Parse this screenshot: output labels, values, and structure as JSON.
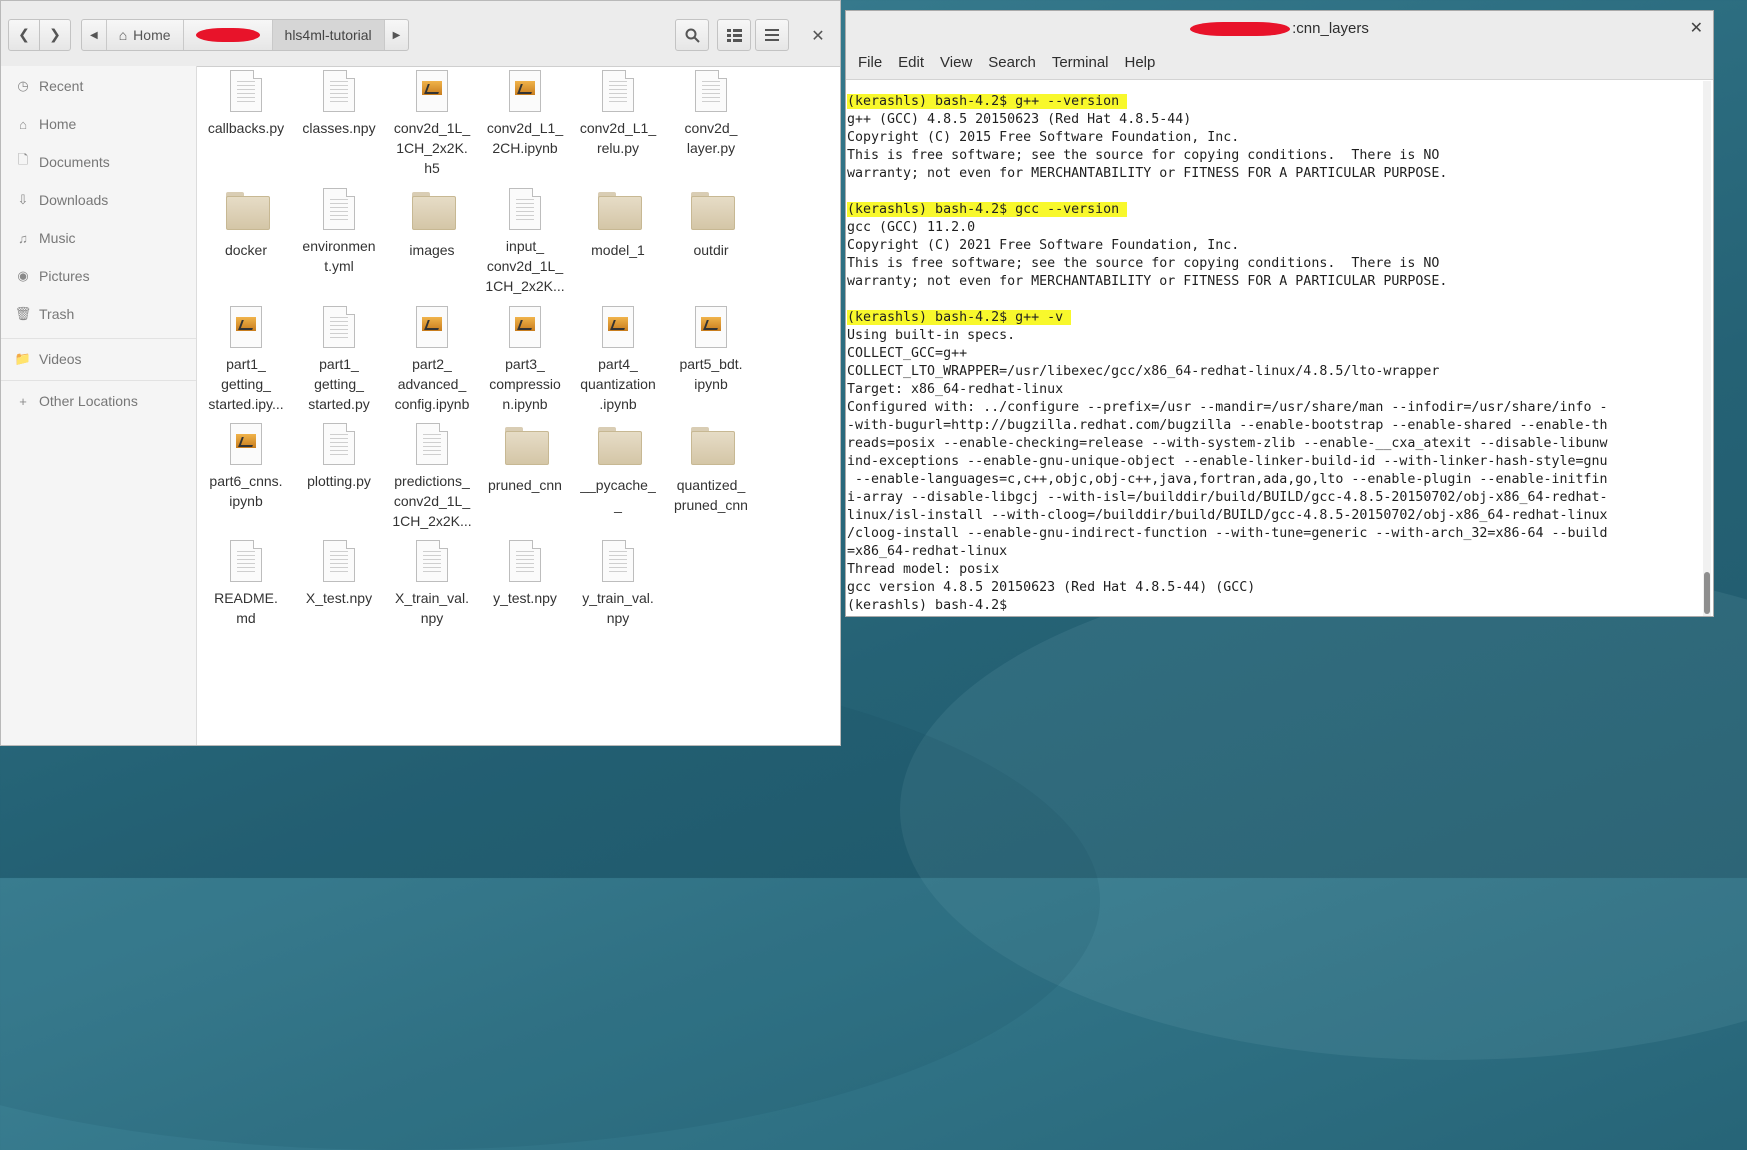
{
  "file_manager": {
    "breadcrumb": {
      "home_label": "Home",
      "current_folder": "hls4ml-tutorial"
    },
    "icons": {
      "back": "chevron-left-icon",
      "forward": "chevron-right-icon",
      "search": "search-icon",
      "view": "view-toggle-icon",
      "menu": "hamburger-menu-icon",
      "close": "close-icon"
    },
    "sidebar": {
      "items": [
        {
          "label": "Recent",
          "icon": "clock-icon"
        },
        {
          "label": "Home",
          "icon": "home-icon"
        },
        {
          "label": "Documents",
          "icon": "document-icon"
        },
        {
          "label": "Downloads",
          "icon": "download-icon"
        },
        {
          "label": "Music",
          "icon": "music-icon"
        },
        {
          "label": "Pictures",
          "icon": "camera-icon"
        },
        {
          "label": "Trash",
          "icon": "trash-icon"
        },
        {
          "label": "Videos",
          "icon": "folder-icon"
        },
        {
          "label": "Other Locations",
          "icon": "plus-icon"
        }
      ]
    },
    "files": [
      {
        "name": "callbacks.py",
        "lines": [
          "callbacks.py"
        ],
        "type": "doc"
      },
      {
        "name": "classes.npy",
        "lines": [
          "classes.npy"
        ],
        "type": "doc"
      },
      {
        "name": "conv2d_1L_1CH_2x2K.h5",
        "lines": [
          "conv2d_1L_",
          "1CH_2x2K.",
          "h5"
        ],
        "type": "nb"
      },
      {
        "name": "conv2d_L1_2CH.ipynb",
        "lines": [
          "conv2d_L1_",
          "2CH.ipynb"
        ],
        "type": "nb"
      },
      {
        "name": "conv2d_L1_relu.py",
        "lines": [
          "conv2d_L1_",
          "relu.py"
        ],
        "type": "doc"
      },
      {
        "name": "conv2d_layer.py",
        "lines": [
          "conv2d_",
          "layer.py"
        ],
        "type": "doc"
      },
      {
        "name": "docker",
        "lines": [
          "docker"
        ],
        "type": "folder"
      },
      {
        "name": "environment.yml",
        "lines": [
          "environmen",
          "t.yml"
        ],
        "type": "doc"
      },
      {
        "name": "images",
        "lines": [
          "images"
        ],
        "type": "folder"
      },
      {
        "name": "input_conv2d_1L_1CH_2x2K...",
        "lines": [
          "input_",
          "conv2d_1L_",
          "1CH_2x2K..."
        ],
        "type": "doc"
      },
      {
        "name": "model_1",
        "lines": [
          "model_1"
        ],
        "type": "folder"
      },
      {
        "name": "outdir",
        "lines": [
          "outdir"
        ],
        "type": "folder"
      },
      {
        "name": "part1_getting_started.ipy...",
        "lines": [
          "part1_",
          "getting_",
          "started.ipy..."
        ],
        "type": "nb"
      },
      {
        "name": "part1_getting_started.py",
        "lines": [
          "part1_",
          "getting_",
          "started.py"
        ],
        "type": "doc"
      },
      {
        "name": "part2_advanced_config.ipynb",
        "lines": [
          "part2_",
          "advanced_",
          "config.ipynb"
        ],
        "type": "nb"
      },
      {
        "name": "part3_compression.ipynb",
        "lines": [
          "part3_",
          "compressio",
          "n.ipynb"
        ],
        "type": "nb"
      },
      {
        "name": "part4_quantization.ipynb",
        "lines": [
          "part4_",
          "quantization",
          ".ipynb"
        ],
        "type": "nb"
      },
      {
        "name": "part5_bdt.ipynb",
        "lines": [
          "part5_bdt.",
          "ipynb"
        ],
        "type": "nb"
      },
      {
        "name": "part6_cnns.ipynb",
        "lines": [
          "part6_cnns.",
          "ipynb"
        ],
        "type": "nb"
      },
      {
        "name": "plotting.py",
        "lines": [
          "plotting.py"
        ],
        "type": "doc"
      },
      {
        "name": "predictions_conv2d_1L_1CH_2x2K...",
        "lines": [
          "predictions_",
          "conv2d_1L_",
          "1CH_2x2K..."
        ],
        "type": "doc"
      },
      {
        "name": "pruned_cnn",
        "lines": [
          "pruned_cnn"
        ],
        "type": "folder"
      },
      {
        "name": "__pycache__",
        "lines": [
          "__pycache_",
          "_"
        ],
        "type": "folder"
      },
      {
        "name": "quantized_pruned_cnn",
        "lines": [
          "quantized_",
          "pruned_cnn"
        ],
        "type": "folder"
      },
      {
        "name": "README.md",
        "lines": [
          "README.",
          "md"
        ],
        "type": "doc"
      },
      {
        "name": "X_test.npy",
        "lines": [
          "X_test.npy"
        ],
        "type": "doc"
      },
      {
        "name": "X_train_val.npy",
        "lines": [
          "X_train_val.",
          "npy"
        ],
        "type": "doc"
      },
      {
        "name": "y_test.npy",
        "lines": [
          "y_test.npy"
        ],
        "type": "doc"
      },
      {
        "name": "y_train_val.npy",
        "lines": [
          "y_train_val.",
          "npy"
        ],
        "type": "doc"
      }
    ]
  },
  "terminal": {
    "title_suffix": ":cnn_layers",
    "menu": [
      "File",
      "Edit",
      "View",
      "Search",
      "Terminal",
      "Help"
    ],
    "lines": [
      {
        "text": "(kerashls) bash-4.2$ g++ --version ",
        "hl": true
      },
      {
        "text": "g++ (GCC) 4.8.5 20150623 (Red Hat 4.8.5-44)",
        "hl": false
      },
      {
        "text": "Copyright (C) 2015 Free Software Foundation, Inc.",
        "hl": false
      },
      {
        "text": "This is free software; see the source for copying conditions.  There is NO",
        "hl": false
      },
      {
        "text": "warranty; not even for MERCHANTABILITY or FITNESS FOR A PARTICULAR PURPOSE.",
        "hl": false
      },
      {
        "text": "",
        "hl": false
      },
      {
        "text": "(kerashls) bash-4.2$ gcc --version ",
        "hl": true
      },
      {
        "text": "gcc (GCC) 11.2.0",
        "hl": false
      },
      {
        "text": "Copyright (C) 2021 Free Software Foundation, Inc.",
        "hl": false
      },
      {
        "text": "This is free software; see the source for copying conditions.  There is NO",
        "hl": false
      },
      {
        "text": "warranty; not even for MERCHANTABILITY or FITNESS FOR A PARTICULAR PURPOSE.",
        "hl": false
      },
      {
        "text": "",
        "hl": false
      },
      {
        "text": "(kerashls) bash-4.2$ g++ -v ",
        "hl": true
      },
      {
        "text": "Using built-in specs.",
        "hl": false
      },
      {
        "text": "COLLECT_GCC=g++",
        "hl": false
      },
      {
        "text": "COLLECT_LTO_WRAPPER=/usr/libexec/gcc/x86_64-redhat-linux/4.8.5/lto-wrapper",
        "hl": false
      },
      {
        "text": "Target: x86_64-redhat-linux",
        "hl": false
      },
      {
        "text": "Configured with: ../configure --prefix=/usr --mandir=/usr/share/man --infodir=/usr/share/info -",
        "hl": false
      },
      {
        "text": "-with-bugurl=http://bugzilla.redhat.com/bugzilla --enable-bootstrap --enable-shared --enable-th",
        "hl": false
      },
      {
        "text": "reads=posix --enable-checking=release --with-system-zlib --enable-__cxa_atexit --disable-libunw",
        "hl": false
      },
      {
        "text": "ind-exceptions --enable-gnu-unique-object --enable-linker-build-id --with-linker-hash-style=gnu",
        "hl": false
      },
      {
        "text": " --enable-languages=c,c++,objc,obj-c++,java,fortran,ada,go,lto --enable-plugin --enable-initfin",
        "hl": false
      },
      {
        "text": "i-array --disable-libgcj --with-isl=/builddir/build/BUILD/gcc-4.8.5-20150702/obj-x86_64-redhat-",
        "hl": false
      },
      {
        "text": "linux/isl-install --with-cloog=/builddir/build/BUILD/gcc-4.8.5-20150702/obj-x86_64-redhat-linux",
        "hl": false
      },
      {
        "text": "/cloog-install --enable-gnu-indirect-function --with-tune=generic --with-arch_32=x86-64 --build",
        "hl": false
      },
      {
        "text": "=x86_64-redhat-linux",
        "hl": false
      },
      {
        "text": "Thread model: posix",
        "hl": false
      },
      {
        "text": "gcc version 4.8.5 20150623 (Red Hat 4.8.5-44) (GCC) ",
        "hl": false
      },
      {
        "text": "(kerashls) bash-4.2$ ",
        "hl": false
      }
    ]
  }
}
